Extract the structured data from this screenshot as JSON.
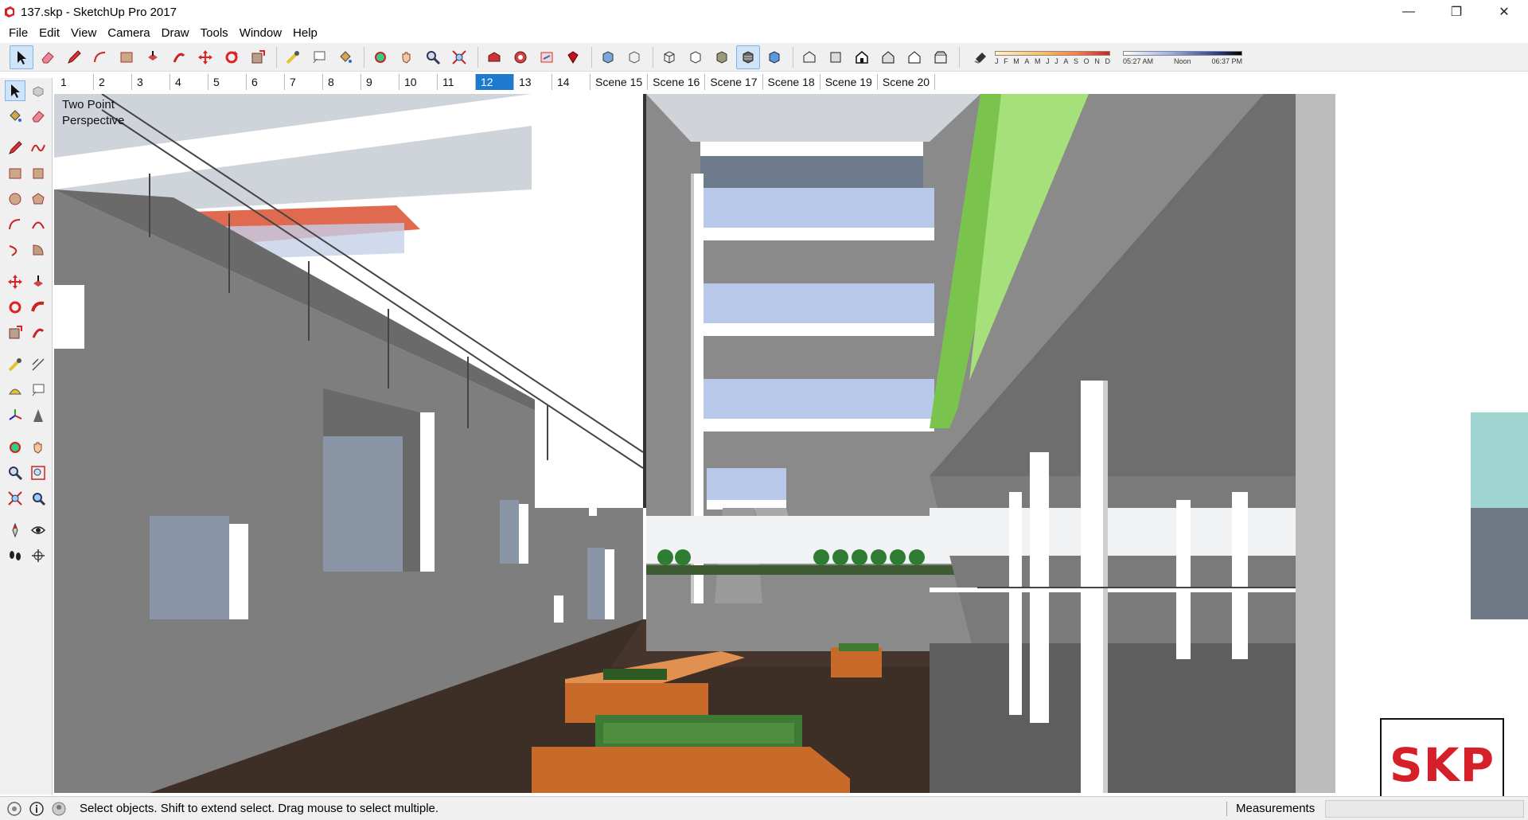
{
  "window": {
    "title": "137.skp - SketchUp Pro 2017",
    "minimize": "—",
    "maximize": "❐",
    "close": "✕"
  },
  "menu": [
    "File",
    "Edit",
    "View",
    "Camera",
    "Draw",
    "Tools",
    "Window",
    "Help"
  ],
  "shadows": {
    "months": [
      "J",
      "F",
      "M",
      "A",
      "M",
      "J",
      "J",
      "A",
      "S",
      "O",
      "N",
      "D"
    ],
    "time_start": "05:27 AM",
    "time_mid": "Noon",
    "time_end": "06:37 PM"
  },
  "scene_tabs": [
    {
      "label": "1"
    },
    {
      "label": "2"
    },
    {
      "label": "3"
    },
    {
      "label": "4"
    },
    {
      "label": "5"
    },
    {
      "label": "6"
    },
    {
      "label": "7"
    },
    {
      "label": "8"
    },
    {
      "label": "9"
    },
    {
      "label": "10"
    },
    {
      "label": "11"
    },
    {
      "label": "12",
      "active": true
    },
    {
      "label": "13"
    },
    {
      "label": "14"
    },
    {
      "label": "Scene 15"
    },
    {
      "label": "Scene 16"
    },
    {
      "label": "Scene 17"
    },
    {
      "label": "Scene 18"
    },
    {
      "label": "Scene 19"
    },
    {
      "label": "Scene 20"
    }
  ],
  "viewport": {
    "camera_label": "Two Point Perspective"
  },
  "status": {
    "hint": "Select objects. Shift to extend select. Drag mouse to select multiple.",
    "measurements_label": "Measurements",
    "measurements_value": ""
  },
  "watermark": "SKP",
  "colors": {
    "accent": "#1e7ad1",
    "floor": "#3d2f26",
    "wall": "#7e7e7e",
    "glass": "#b8c8e8",
    "green_fin": "#a6e07a",
    "planter_wood": "#c86a2a",
    "logo_red": "#d5202a"
  }
}
